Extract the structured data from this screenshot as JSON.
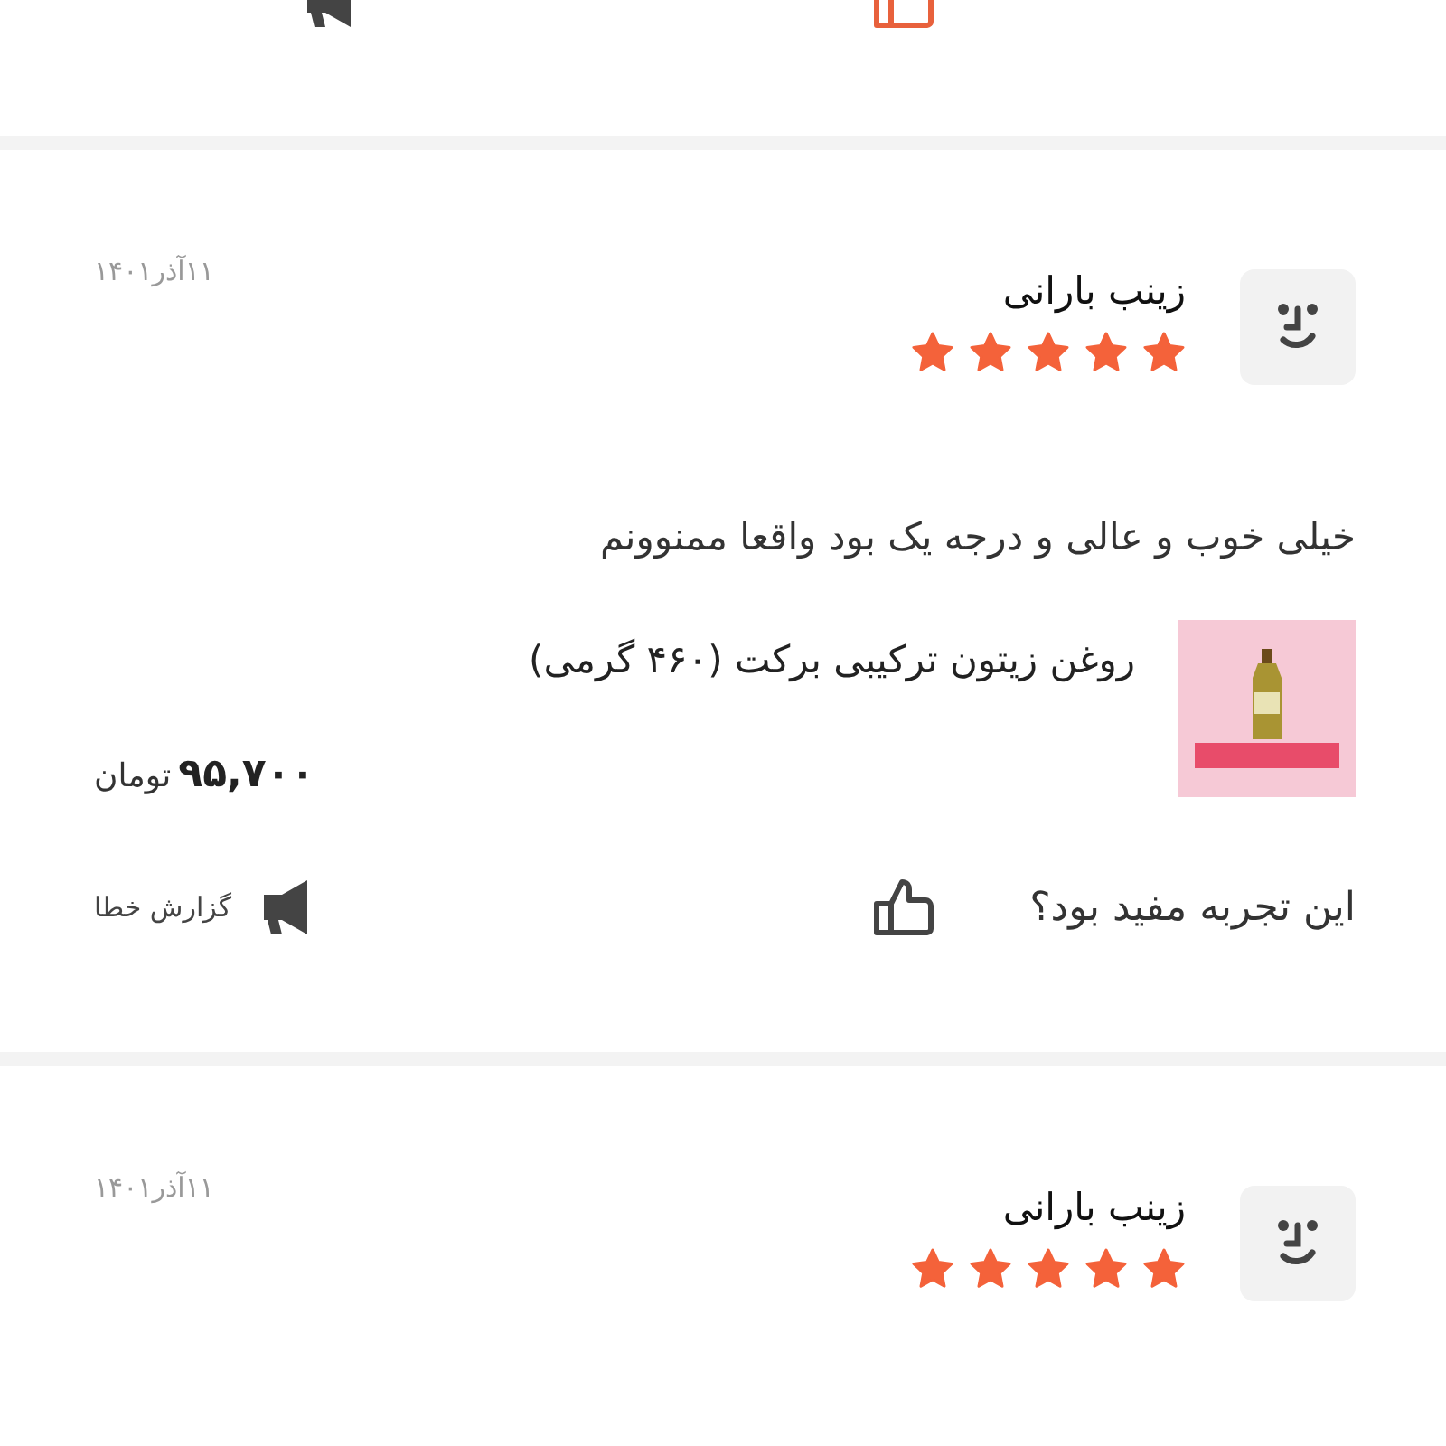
{
  "previous_review_actions": {
    "liked": true
  },
  "reviews": [
    {
      "name": "زینب بارانی",
      "date": "۱۱آذر۱۴۰۱",
      "stars": 5,
      "comment": "خیلی خوب و عالی و درجه یک بود واقعا ممنوونم",
      "product": {
        "title": "روغن زیتون ترکیبی برکت (۴۶۰ گرمی)",
        "price": "۹۵,۷۰۰",
        "currency": "تومان"
      },
      "question": "این تجربه مفید بود؟",
      "liked": false,
      "report": "گزارش خطا"
    },
    {
      "name": "زینب بارانی",
      "date": "۱۱آذر۱۴۰۱",
      "stars": 5
    }
  ]
}
